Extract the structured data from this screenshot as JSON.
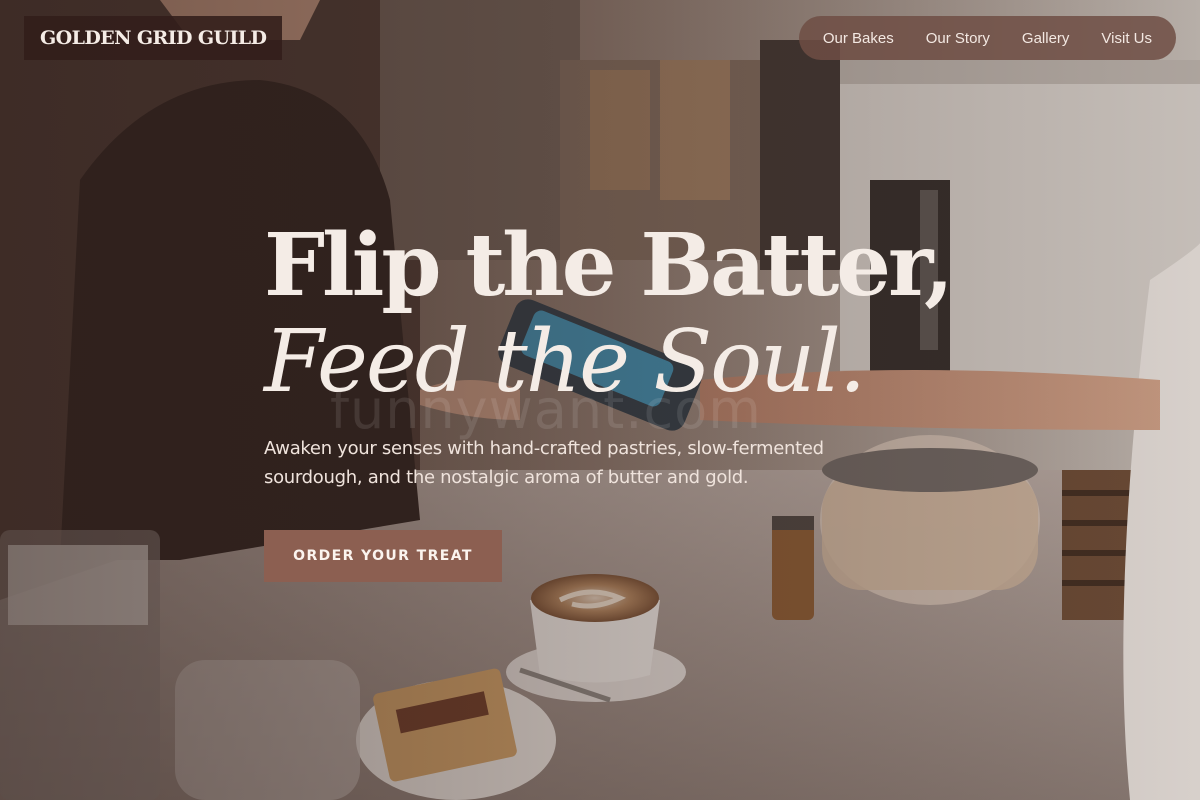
{
  "header": {
    "brand": "GOLDEN GRID GUILD",
    "nav": [
      {
        "label": "Our Bakes"
      },
      {
        "label": "Our Story"
      },
      {
        "label": "Gallery"
      },
      {
        "label": "Visit Us"
      }
    ]
  },
  "hero": {
    "headline_line1": "Flip the Batter,",
    "headline_line2": "Feed the Soul.",
    "subtext": "Awaken your senses with hand-crafted pastries, slow-fermented sourdough, and the nostalgic aroma of butter and gold.",
    "cta_label": "ORDER YOUR TREAT",
    "watermark": "funnywant.com"
  },
  "theme": {
    "brand_bg": "#32201b",
    "nav_bg": "#6e4e44",
    "cta_bg": "#8c5f51",
    "text_light": "#f4ece6"
  }
}
